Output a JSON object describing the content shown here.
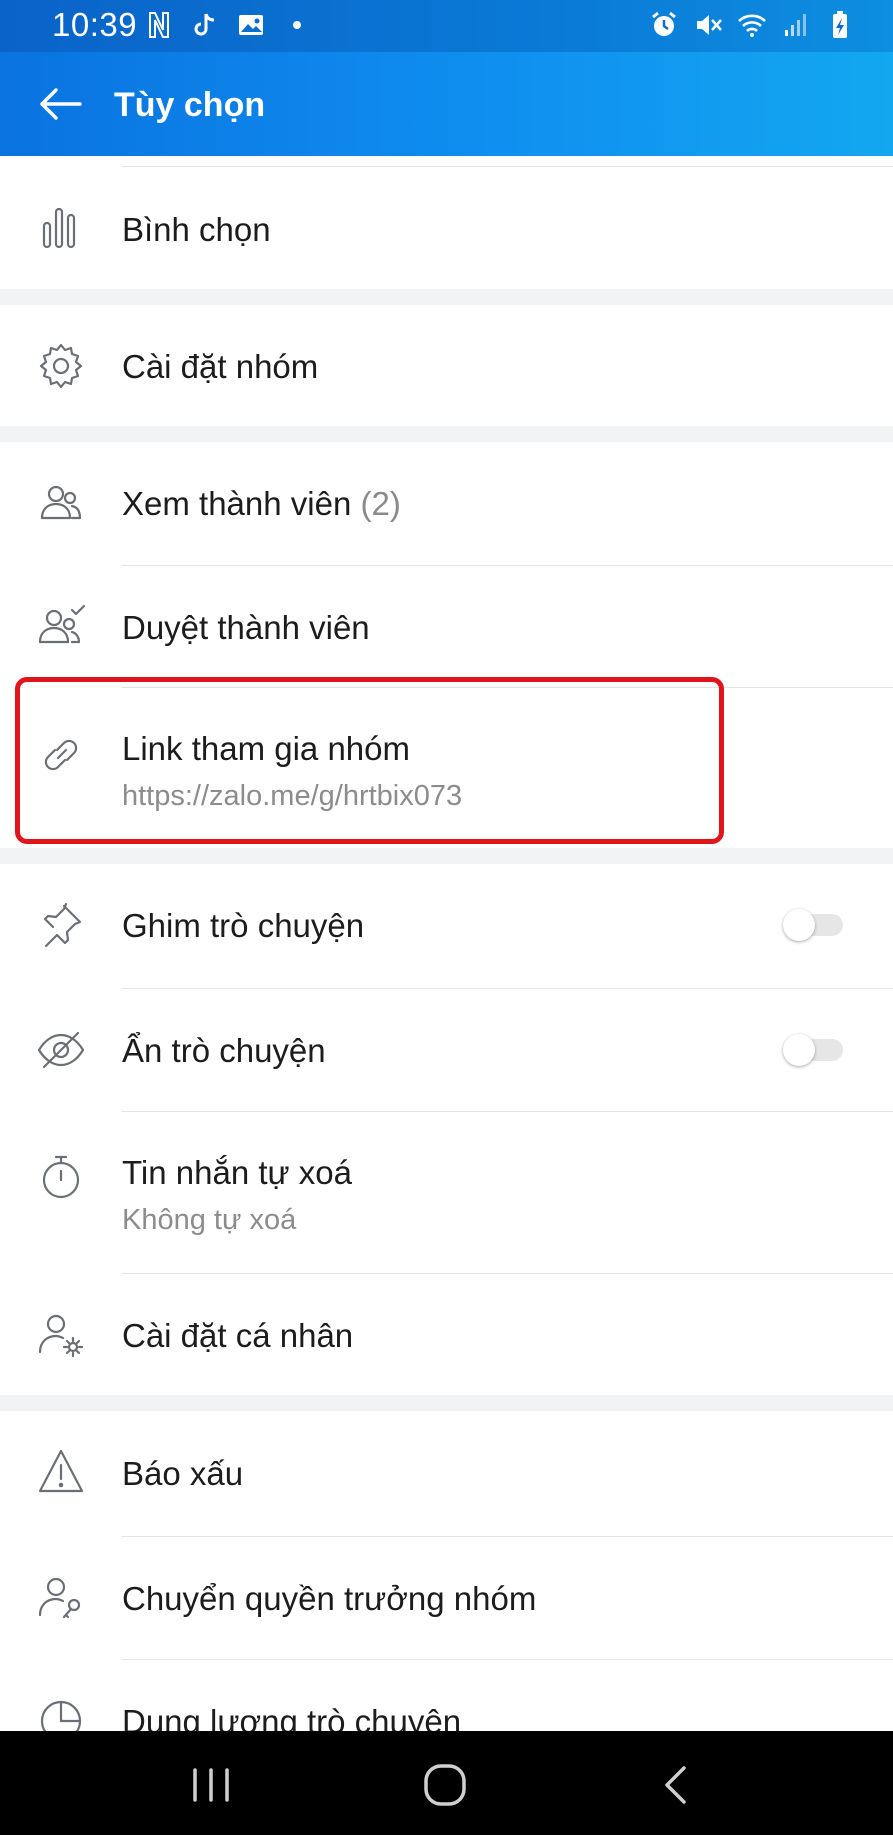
{
  "status_bar": {
    "time": "10:39",
    "left_icons": [
      "netflix-n-icon",
      "tiktok-icon",
      "gallery-icon",
      "dot-icon"
    ],
    "right_icons": [
      "alarm-icon",
      "mute-icon",
      "wifi-icon",
      "signal-icon",
      "battery-charging-icon"
    ]
  },
  "header": {
    "title": "Tùy chọn",
    "back_icon": "arrow-left-icon",
    "accent_color": "#0a7fe6"
  },
  "menu": {
    "poll": {
      "label": "Bình chọn",
      "icon": "poll-bars-icon"
    },
    "group_settings": {
      "label": "Cài đặt nhóm",
      "icon": "gear-icon"
    },
    "view_members": {
      "label": "Xem thành viên",
      "count": "(2)",
      "icon": "people-icon"
    },
    "approve_members": {
      "label": "Duyệt thành viên",
      "icon": "people-check-icon"
    },
    "group_link": {
      "label": "Link tham gia nhóm",
      "sub": "https://zalo.me/g/hrtbix073",
      "icon": "link-icon"
    },
    "pin_chat": {
      "label": "Ghim trò chuyện",
      "icon": "pin-icon",
      "toggle_on": false
    },
    "hide_chat": {
      "label": "Ẩn trò chuyện",
      "icon": "eye-off-icon",
      "toggle_on": false
    },
    "auto_delete": {
      "label": "Tin nhắn tự xoá",
      "sub": "Không tự xoá",
      "icon": "timer-icon"
    },
    "personal_settings": {
      "label": "Cài đặt cá nhân",
      "icon": "person-gear-icon"
    },
    "report": {
      "label": "Báo xấu",
      "icon": "warning-icon"
    },
    "transfer_owner": {
      "label": "Chuyển quyền trưởng nhóm",
      "icon": "person-key-icon"
    },
    "storage": {
      "label": "Dung lượng trò chuyện",
      "icon": "pie-chart-icon"
    }
  },
  "nav_bar": {
    "buttons": [
      "recent-apps-icon",
      "home-icon",
      "back-icon"
    ]
  },
  "highlight_color": "#e2141b"
}
